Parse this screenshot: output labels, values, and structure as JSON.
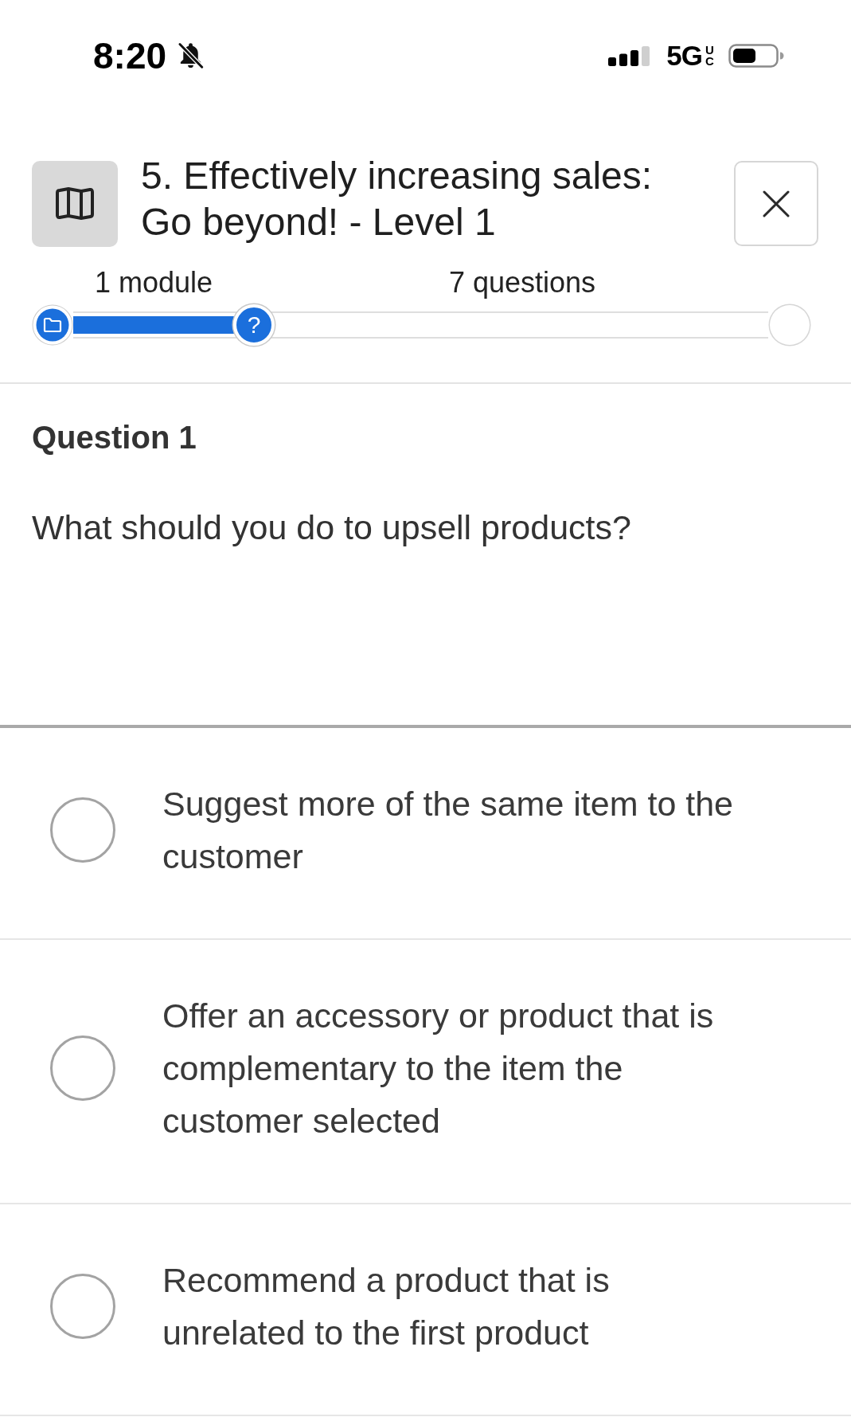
{
  "status_bar": {
    "time": "8:20",
    "network": "5G",
    "network_suffix": "UC"
  },
  "header": {
    "title": "5. Effectively increasing sales: Go beyond! - Level 1"
  },
  "progress": {
    "level": 0.26,
    "labels": [
      "1 module",
      "7 questions"
    ],
    "current_marker": "?"
  },
  "question": {
    "heading": "Question 1",
    "text": "What should you do to upsell products?"
  },
  "options": [
    {
      "text": "Suggest more of the same item to the customer",
      "selected": false
    },
    {
      "text": "Offer an accessory or product that is complementary to the item the customer selected",
      "selected": false
    },
    {
      "text": "Recommend a product that is unrelated to the first product",
      "selected": false
    }
  ]
}
